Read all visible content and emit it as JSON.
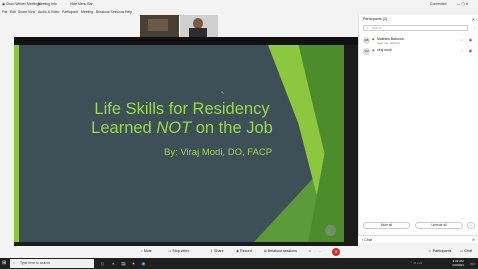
{
  "window": {
    "app_title": "Cisco Webex Meetings",
    "tab1": "Meeting Info",
    "tab2": "Hide Menu Bar",
    "status": "Connected",
    "controls": "— ▢ ✕"
  },
  "menu": [
    "File",
    "Edit",
    "Share",
    "View",
    "Audio & Video",
    "Participant",
    "Meeting",
    "Breakout Sessions",
    "Help"
  ],
  "slide": {
    "title_line1": "Life Skills for Residency",
    "title_line2_a": "Learned ",
    "title_line2_b": "NOT",
    "title_line2_c": " on the Job",
    "author": "By: Viraj Modi, DO, FACP",
    "colors": {
      "bg": "#3d4f57",
      "accent": "#8dc63f"
    }
  },
  "participants": {
    "header": "Participants (2)",
    "search_placeholder": "Search",
    "list": [
      {
        "initials": "MB",
        "name": "Matthew Babcock",
        "subtitle": "Host, me, referred"
      },
      {
        "initials": "VM",
        "name": "viraj modi",
        "subtitle": ""
      }
    ],
    "mute_all": "Mute all",
    "unmute_all": "Unmute all",
    "more": "..."
  },
  "chat": {
    "label": "Chat"
  },
  "controls": {
    "mute": "Mute",
    "stop_video": "Stop video",
    "share": "Share",
    "record": "Record",
    "breakout": "Breakout sessions",
    "more": "...",
    "participants": "Participants",
    "chat": "Chat"
  },
  "taskbar": {
    "search_placeholder": "Type here to search",
    "time": "9:03 AM",
    "date": "2/3/2021"
  }
}
